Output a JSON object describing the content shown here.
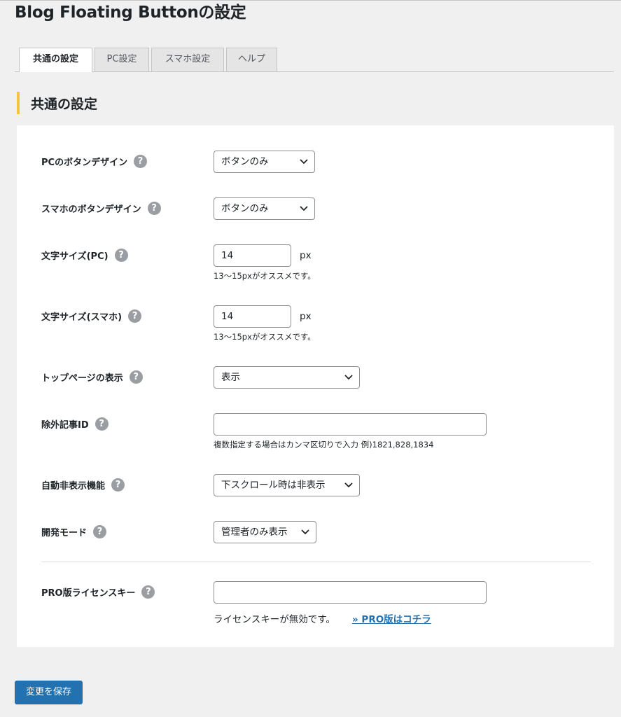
{
  "page": {
    "title": "Blog Floating Buttonの設定"
  },
  "tabs": [
    {
      "label": "共通の設定",
      "active": true
    },
    {
      "label": "PC設定",
      "active": false
    },
    {
      "label": "スマホ設定",
      "active": false
    },
    {
      "label": "ヘルプ",
      "active": false
    }
  ],
  "section": {
    "title": "共通の設定"
  },
  "help_glyph": "?",
  "fields": {
    "pc_button_design": {
      "label": "PCのボタンデザイン",
      "value": "ボタンのみ"
    },
    "sp_button_design": {
      "label": "スマホのボタンデザイン",
      "value": "ボタンのみ"
    },
    "font_size_pc": {
      "label": "文字サイズ(PC)",
      "value": "14",
      "unit": "px",
      "hint": "13〜15pxがオススメです。"
    },
    "font_size_sp": {
      "label": "文字サイズ(スマホ)",
      "value": "14",
      "unit": "px",
      "hint": "13〜15pxがオススメです。"
    },
    "top_page_display": {
      "label": "トップページの表示",
      "value": "表示"
    },
    "exclude_ids": {
      "label": "除外記事ID",
      "value": "",
      "hint": "複数指定する場合はカンマ区切りで入力 例)1821,828,1834"
    },
    "auto_hide": {
      "label": "自動非表示機能",
      "value": "下スクロール時は非表示"
    },
    "dev_mode": {
      "label": "開発モード",
      "value": "管理者のみ表示"
    },
    "license_key": {
      "label": "PRO版ライセンスキー",
      "value": "",
      "status": "ライセンスキーが無効です。",
      "link": "» PRO版はコチラ"
    }
  },
  "save_button": {
    "label": "変更を保存"
  },
  "colors": {
    "accent": "#2271b1",
    "section_marker": "#f5c242"
  },
  "icons": {
    "help": "help-icon",
    "dropdown": "chevron-down-icon"
  }
}
